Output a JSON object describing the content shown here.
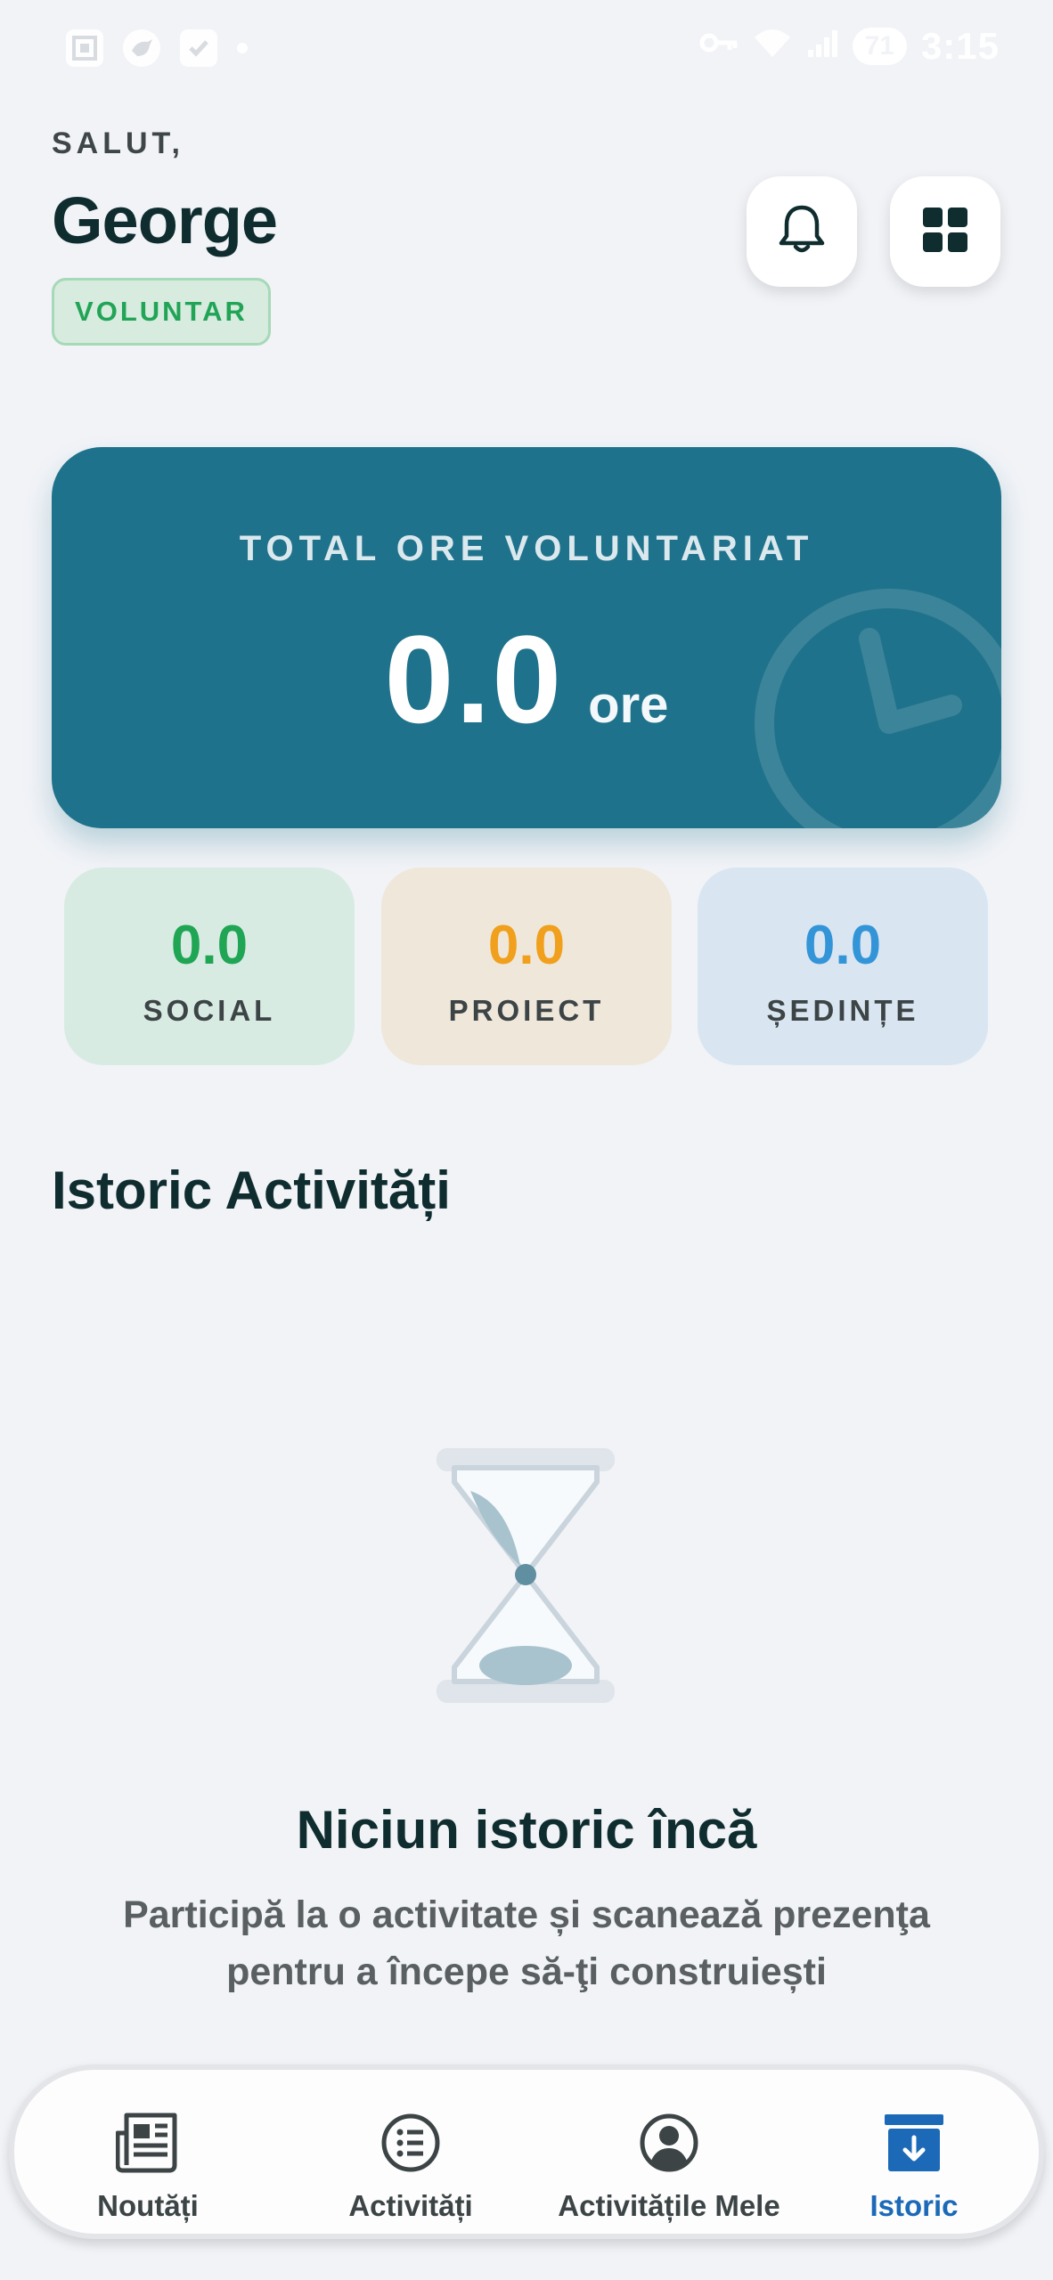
{
  "status_bar": {
    "time": "3:15",
    "battery": "71",
    "left_icons": [
      "screenshot-icon",
      "bird-icon",
      "checkbox-icon",
      "dot-icon"
    ],
    "right_icons": [
      "key-icon",
      "wifi-icon",
      "signal-icon"
    ]
  },
  "header": {
    "greeting": "SALUT,",
    "user_name": "George",
    "role": "VOLUNTAR",
    "bell_icon": "bell-icon",
    "menu_icon": "grid-icon"
  },
  "hero": {
    "label": "TOTAL ORE VOLUNTARIAT",
    "value": "0.0",
    "unit": "ore",
    "background_color": "#1f728b"
  },
  "stats": [
    {
      "value": "0.0",
      "label": "SOCIAL",
      "color": "#1fa554"
    },
    {
      "value": "0.0",
      "label": "PROIECT",
      "color": "#f0a01c"
    },
    {
      "value": "0.0",
      "label": "ȘEDINȚE",
      "color": "#3394d8"
    }
  ],
  "history": {
    "title": "Istoric Activități",
    "empty_icon": "hourglass-icon",
    "empty_title": "Niciun istoric încă",
    "empty_desc": "Participă la o activitate și scanează prezenţa pentru a începe să-ţi construiești"
  },
  "bottom_nav": {
    "items": [
      {
        "label": "Noutăți",
        "icon": "newspaper-icon",
        "active": false
      },
      {
        "label": "Activități",
        "icon": "list-icon",
        "active": false
      },
      {
        "label": "Activitățile Mele",
        "icon": "profile-icon",
        "active": false
      },
      {
        "label": "Istoric",
        "icon": "archive-icon",
        "active": true
      }
    ],
    "active_color": "#1c6ab7"
  }
}
